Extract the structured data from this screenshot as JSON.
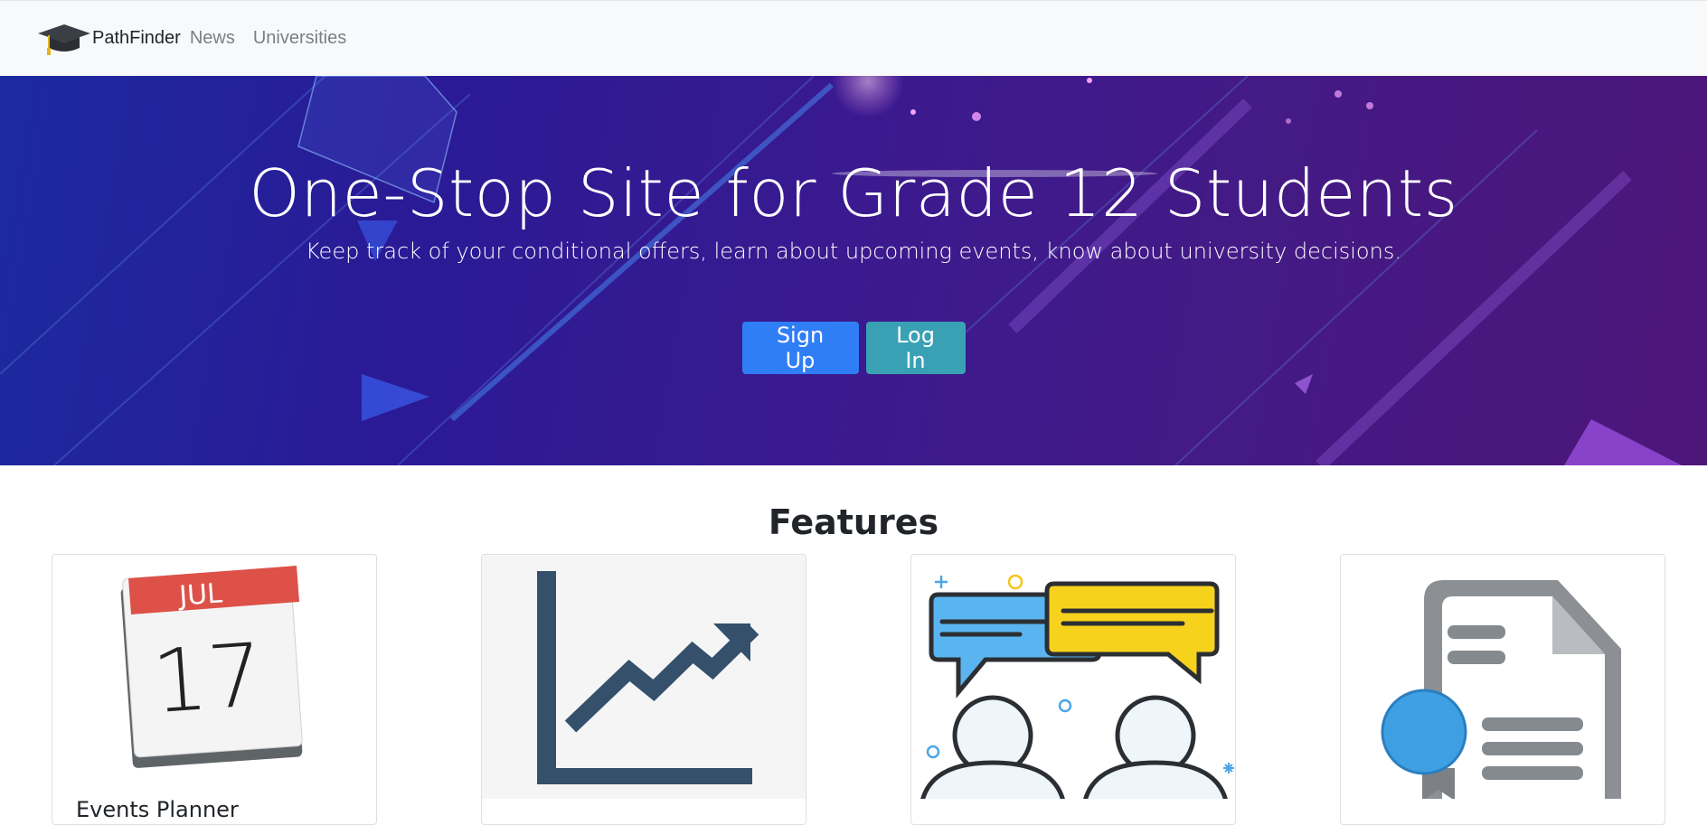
{
  "navbar": {
    "brand": "PathFinder",
    "links": [
      "News",
      "Universities"
    ]
  },
  "hero": {
    "title": "One-Stop Site for Grade 12 Students",
    "subtitle": "Keep track of your conditional offers, learn about upcoming events, know about university decisions.",
    "signup_label": "Sign Up",
    "login_label": "Log In"
  },
  "features": {
    "heading": "Features",
    "cards": [
      {
        "title": "Events Planner",
        "icon": "calendar-icon",
        "calendar_month": "JUL",
        "calendar_day": "17"
      },
      {
        "title": "",
        "icon": "trend-chart-icon"
      },
      {
        "title": "",
        "icon": "chat-users-icon"
      },
      {
        "title": "",
        "icon": "certificate-document-icon"
      }
    ]
  },
  "colors": {
    "primary": "#2f7ef6",
    "info": "#3aa1b5",
    "navbar_bg": "#f8f9fa",
    "hero_start": "#1c2aa0",
    "hero_end": "#4d1679"
  }
}
